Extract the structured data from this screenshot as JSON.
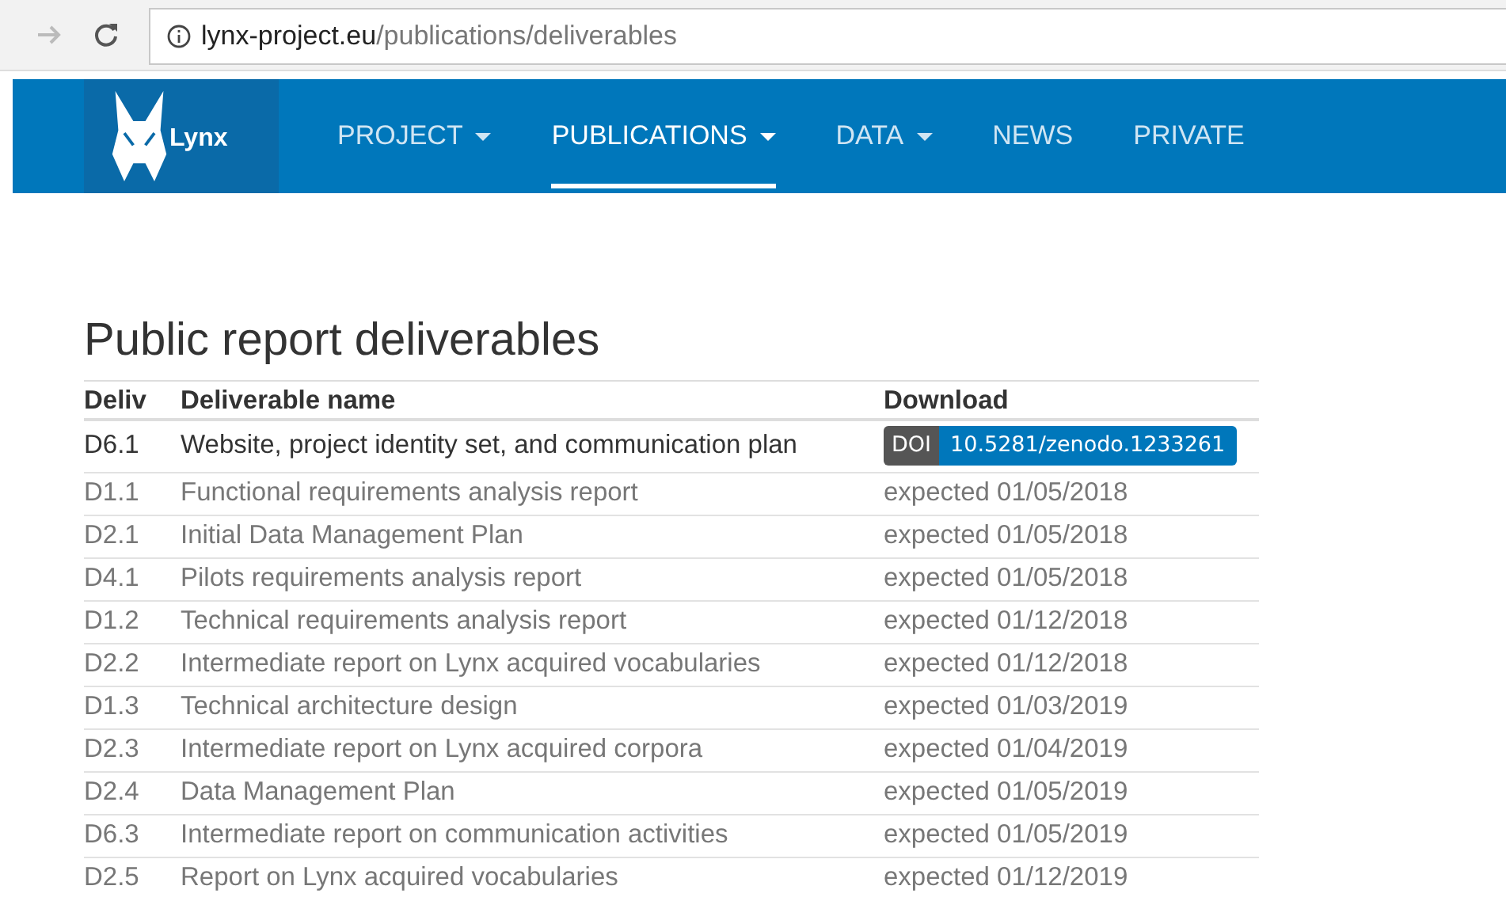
{
  "browser": {
    "url_host": "lynx-project.eu",
    "url_path": "/publications/deliverables"
  },
  "navbar": {
    "logo_text": "Lynx",
    "items": [
      {
        "label": "PROJECT",
        "dropdown": true,
        "selected": false
      },
      {
        "label": "PUBLICATIONS",
        "dropdown": true,
        "selected": true
      },
      {
        "label": "DATA",
        "dropdown": true,
        "selected": false
      },
      {
        "label": "NEWS",
        "dropdown": false,
        "selected": false
      },
      {
        "label": "PRIVATE",
        "dropdown": false,
        "selected": false
      }
    ]
  },
  "page_title": "Public report deliverables",
  "table": {
    "columns": [
      "Deliv",
      "Deliverable name",
      "Download"
    ],
    "rows": [
      {
        "id": "D6.1",
        "name": "Website, project identity set, and communication plan",
        "kind": "doi",
        "badge_label": "DOI",
        "download": "10.5281/zenodo.1233261"
      },
      {
        "id": "D1.1",
        "name": "Functional requirements analysis report",
        "kind": "expected",
        "download": "expected 01/05/2018"
      },
      {
        "id": "D2.1",
        "name": "Initial Data Management Plan",
        "kind": "expected",
        "download": "expected 01/05/2018"
      },
      {
        "id": "D4.1",
        "name": "Pilots requirements analysis report",
        "kind": "expected",
        "download": "expected 01/05/2018"
      },
      {
        "id": "D1.2",
        "name": "Technical requirements analysis report",
        "kind": "expected",
        "download": "expected 01/12/2018"
      },
      {
        "id": "D2.2",
        "name": "Intermediate report on Lynx acquired vocabularies",
        "kind": "expected",
        "download": "expected 01/12/2018"
      },
      {
        "id": "D1.3",
        "name": "Technical architecture design",
        "kind": "expected",
        "download": "expected 01/03/2019"
      },
      {
        "id": "D2.3",
        "name": "Intermediate report on Lynx acquired corpora",
        "kind": "expected",
        "download": "expected 01/04/2019"
      },
      {
        "id": "D2.4",
        "name": "Data Management Plan",
        "kind": "expected",
        "download": "expected 01/05/2019"
      },
      {
        "id": "D6.3",
        "name": "Intermediate report on communication activities",
        "kind": "expected",
        "download": "expected 01/05/2019"
      },
      {
        "id": "D2.5",
        "name": "Report on Lynx acquired vocabularies",
        "kind": "expected",
        "download": "expected 01/12/2019"
      }
    ]
  }
}
